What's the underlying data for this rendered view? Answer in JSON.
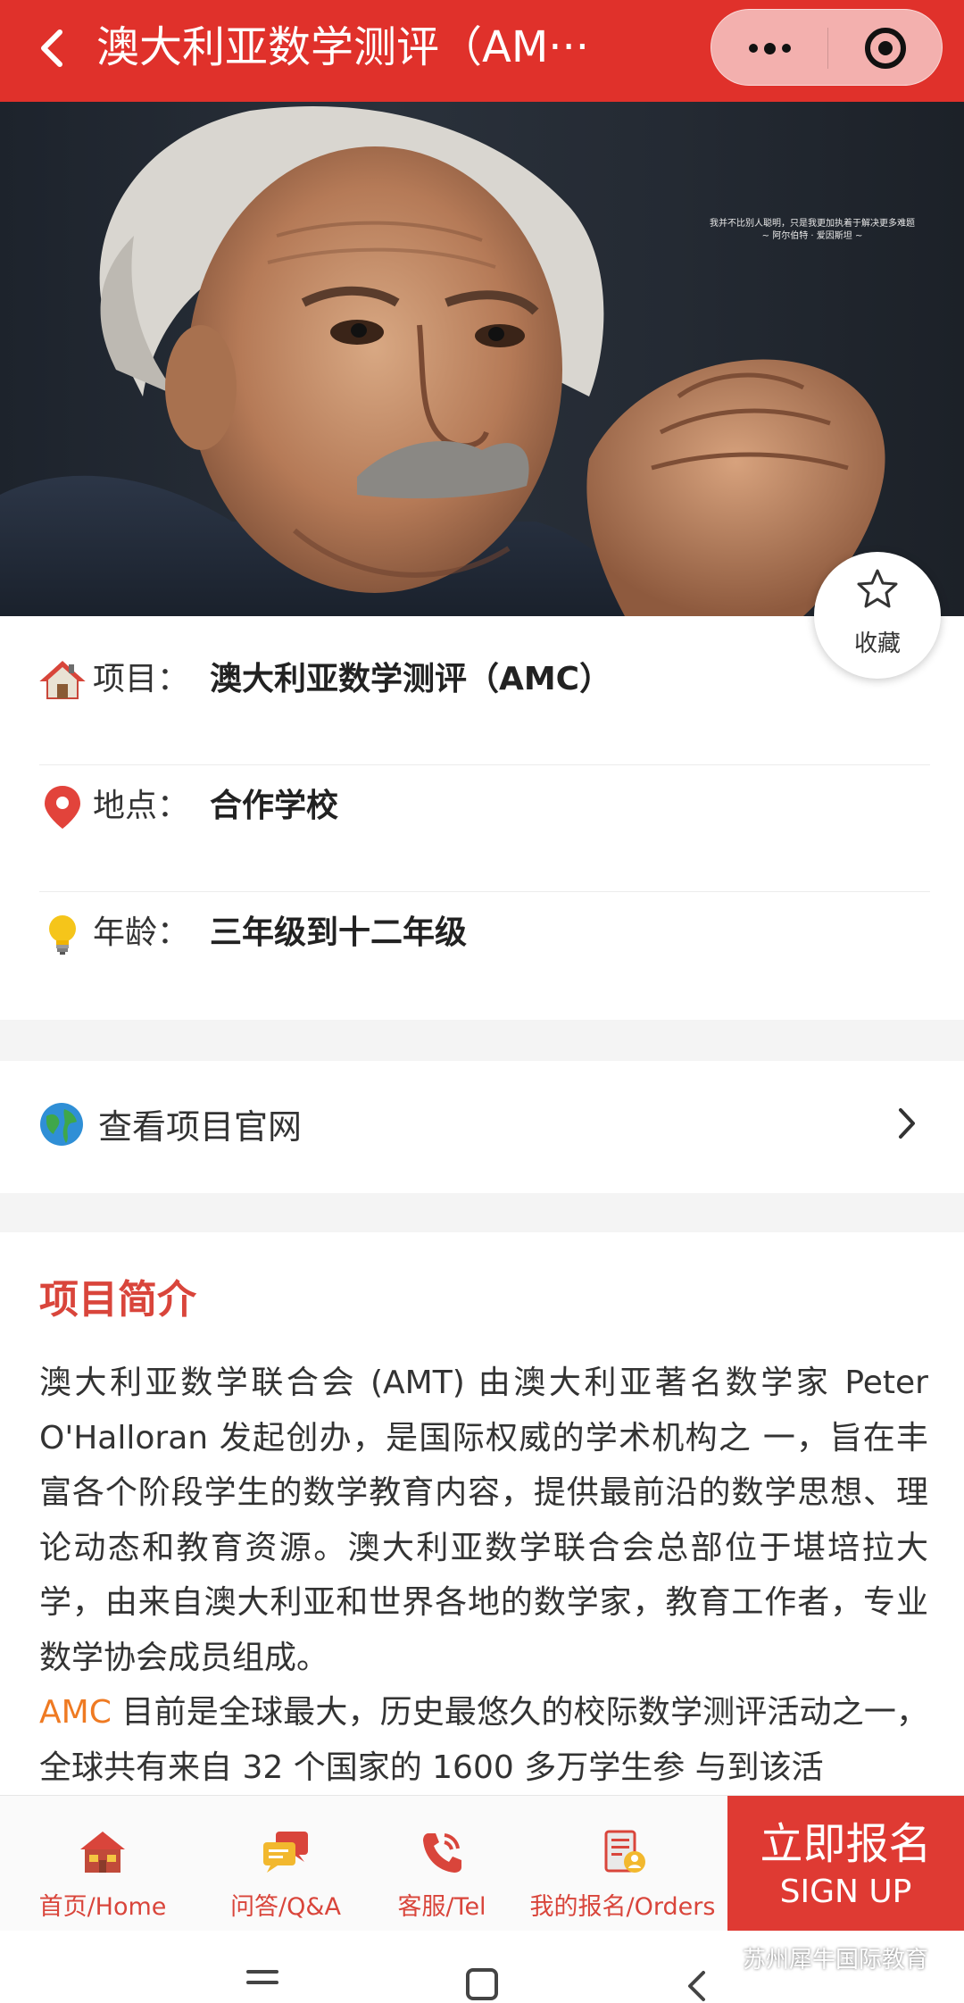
{
  "header": {
    "title": "澳大利亚数学测评（AM···",
    "back_icon": "chevron-left-icon",
    "more_icon": "more-dots-icon",
    "close_icon": "target-circle-icon",
    "background": "#e0312b"
  },
  "hero": {
    "quote_line1": "我并不比别人聪明，只是我更加执着于解决更多难题",
    "quote_line2": "~ 阿尔伯特 · 爱因斯坦 ~",
    "image_subject": "portrait photo"
  },
  "favorite": {
    "label": "收藏",
    "icon": "star-outline-icon"
  },
  "info": {
    "rows": [
      {
        "icon": "house-icon",
        "label": "项目：",
        "value": "澳大利亚数学测评（AMC）"
      },
      {
        "icon": "location-pin-icon",
        "label": "地点：",
        "value": "合作学校"
      },
      {
        "icon": "lightbulb-icon",
        "label": "年龄：",
        "value": "三年级到十二年级"
      }
    ]
  },
  "website": {
    "label": "查看项目官网",
    "icon": "globe-icon",
    "chevron_icon": "chevron-right-icon"
  },
  "intro": {
    "title": "项目简介",
    "para1": "澳大利亚数学联合会 (AMT) 由澳大利亚著名数学家 Peter O'Halloran 发起创办，是国际权威的学术机构之 一，旨在丰富各个阶段学生的数学教育内容，提供最前沿的数学思想、理论动态和教育资源。澳大利亚数学联合会总部位于堪培拉大学，由来自澳大利亚和世界各地的数学家，教育工作者，专业数学协会成员组成。",
    "para2_highlight": "AMC",
    "para2_rest": " 目前是全球最大，历史最悠久的校际数学测评活动之一，全球共有来自 32 个国家的 1600 多万学生参 与到该活",
    "title_color": "#d9453b",
    "highlight_color": "#ef7a22"
  },
  "tabbar": {
    "tabs": [
      {
        "label": "首页/Home",
        "icon": "home-icon"
      },
      {
        "label": "问答/Q&A",
        "icon": "chat-bubbles-icon"
      },
      {
        "label": "客服/Tel",
        "icon": "phone-icon"
      },
      {
        "label": "我的报名/Orders",
        "icon": "orders-icon"
      }
    ],
    "signup_cn": "立即报名",
    "signup_en": "SIGN UP",
    "accent": "#df3a33"
  },
  "system_nav": {
    "watermark": "苏州犀牛国际教育"
  }
}
